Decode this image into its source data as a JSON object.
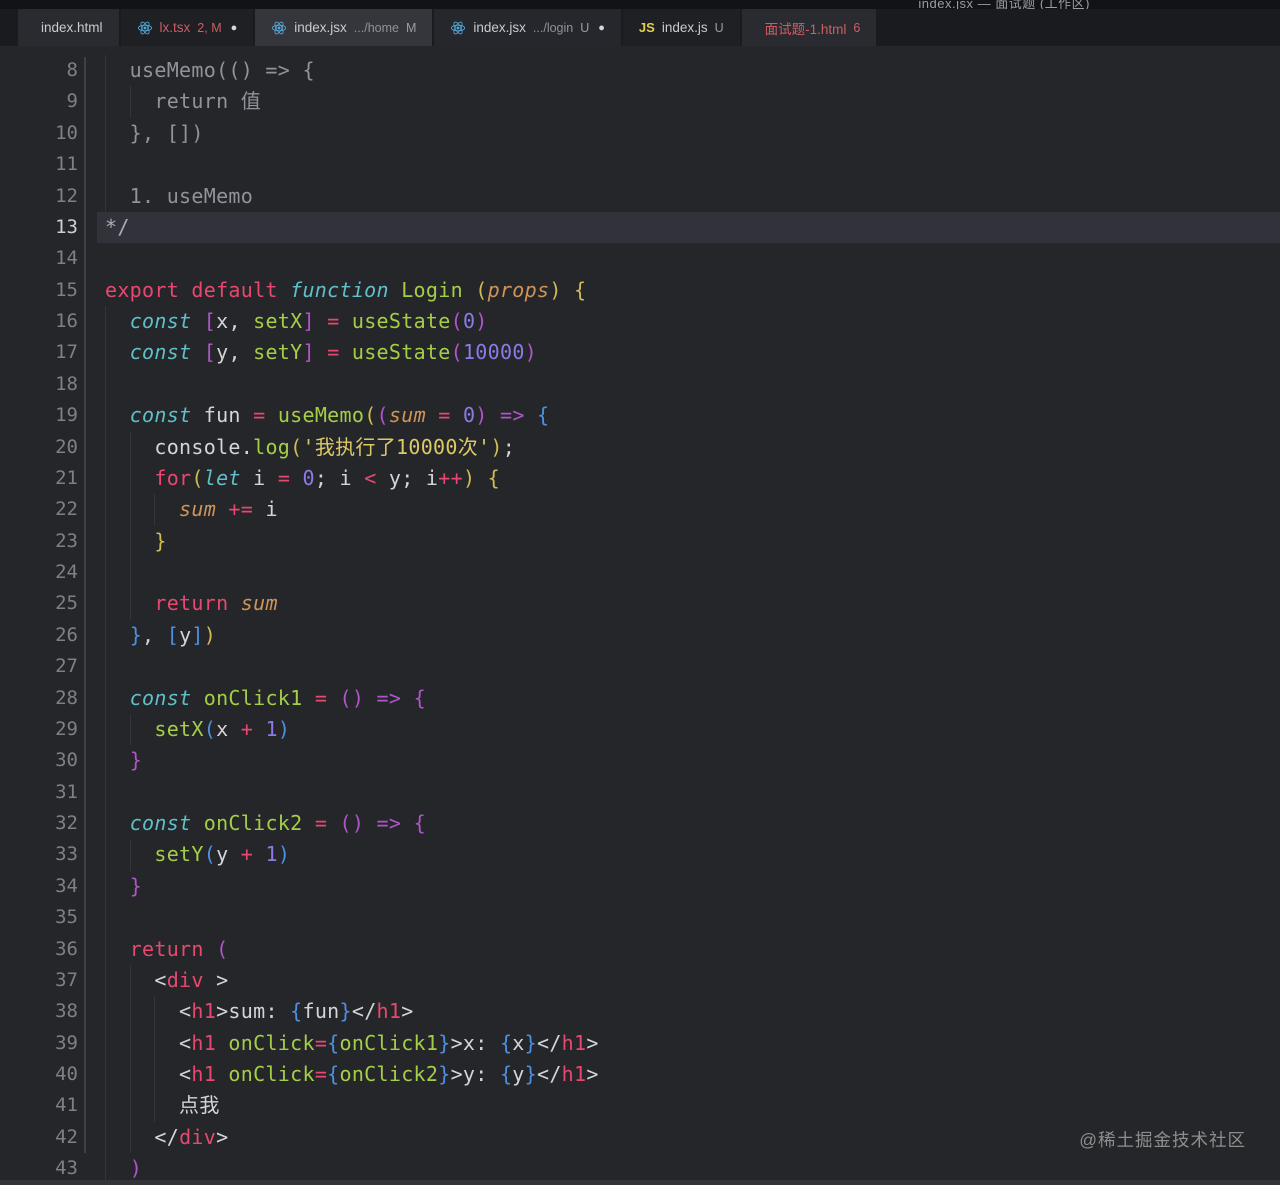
{
  "window": {
    "title": "index.jsx — 面试题 (工作区)"
  },
  "tabs": [
    {
      "icon": "code-icon",
      "label": "index.html",
      "detail": "",
      "suffix": "",
      "dirty": false,
      "error": false,
      "shade": "mid"
    },
    {
      "icon": "react-icon",
      "label": "lx.tsx",
      "detail": "",
      "suffix": "2, M",
      "dirty": true,
      "error": true,
      "shade": "dark"
    },
    {
      "icon": "react-icon",
      "label": "index.jsx",
      "detail": ".../home",
      "suffix": "M",
      "dirty": false,
      "error": false,
      "shade": "light"
    },
    {
      "icon": "react-icon",
      "label": "index.jsx",
      "detail": ".../login",
      "suffix": "U",
      "dirty": true,
      "error": false,
      "shade": "middark"
    },
    {
      "icon": "js-icon",
      "label": "index.js",
      "detail": "",
      "suffix": "U",
      "dirty": false,
      "error": false,
      "shade": "dark"
    },
    {
      "icon": "code-icon",
      "label": "面试题-1.html",
      "detail": "",
      "suffix": "6",
      "dirty": false,
      "error": true,
      "shade": "mid"
    }
  ],
  "colors": {
    "c": "#90939b",
    "c2": "#a8acb4",
    "kw": "#e8486f",
    "st": "#5fc0c9",
    "fn": "#a5ce47",
    "pm": "#d09457",
    "nu": "#8d79e8",
    "sr": "#ddc966",
    "pl": "#d4d5d8",
    "by": "#cfbc55",
    "bp": "#b055c9",
    "bb": "#4e90e0",
    "tg": "#e8486f",
    "accent_react": "#53aede"
  },
  "editor": {
    "first_line": 8,
    "active_line": 13,
    "lines": [
      [
        [
          "  useMemo(() => {",
          "c"
        ]
      ],
      [
        [
          "    return 值",
          "c"
        ]
      ],
      [
        [
          "  }, [])",
          "c"
        ]
      ],
      [],
      [
        [
          "  1. useMemo",
          "c"
        ]
      ],
      [
        [
          "*/",
          "c2"
        ]
      ],
      [],
      [
        [
          "export",
          "kw"
        ],
        [
          " ",
          "pl"
        ],
        [
          "default",
          "kw"
        ],
        [
          " ",
          "pl"
        ],
        [
          "function",
          "st"
        ],
        [
          " ",
          "pl"
        ],
        [
          "Login",
          "fn"
        ],
        [
          " ",
          "pl"
        ],
        [
          "(",
          "by"
        ],
        [
          "props",
          "pm"
        ],
        [
          ")",
          "by"
        ],
        [
          " ",
          "pl"
        ],
        [
          "{",
          "by"
        ]
      ],
      [
        [
          "  ",
          "pl"
        ],
        [
          "const",
          "st"
        ],
        [
          " ",
          "pl"
        ],
        [
          "[",
          "bp"
        ],
        [
          "x",
          "pl"
        ],
        [
          ", ",
          "pl"
        ],
        [
          "setX",
          "fn"
        ],
        [
          "]",
          "bp"
        ],
        [
          " ",
          "pl"
        ],
        [
          "=",
          "kw"
        ],
        [
          " ",
          "pl"
        ],
        [
          "useState",
          "fn"
        ],
        [
          "(",
          "bp"
        ],
        [
          "0",
          "nu"
        ],
        [
          ")",
          "bp"
        ]
      ],
      [
        [
          "  ",
          "pl"
        ],
        [
          "const",
          "st"
        ],
        [
          " ",
          "pl"
        ],
        [
          "[",
          "bp"
        ],
        [
          "y",
          "pl"
        ],
        [
          ", ",
          "pl"
        ],
        [
          "setY",
          "fn"
        ],
        [
          "]",
          "bp"
        ],
        [
          " ",
          "pl"
        ],
        [
          "=",
          "kw"
        ],
        [
          " ",
          "pl"
        ],
        [
          "useState",
          "fn"
        ],
        [
          "(",
          "bp"
        ],
        [
          "10000",
          "nu"
        ],
        [
          ")",
          "bp"
        ]
      ],
      [],
      [
        [
          "  ",
          "pl"
        ],
        [
          "const",
          "st"
        ],
        [
          " ",
          "pl"
        ],
        [
          "fun",
          "pl"
        ],
        [
          " ",
          "pl"
        ],
        [
          "=",
          "kw"
        ],
        [
          " ",
          "pl"
        ],
        [
          "useMemo",
          "fn"
        ],
        [
          "(",
          "by"
        ],
        [
          "(",
          "bp"
        ],
        [
          "sum",
          "pm"
        ],
        [
          " ",
          "pl"
        ],
        [
          "=",
          "kw"
        ],
        [
          " ",
          "pl"
        ],
        [
          "0",
          "nu"
        ],
        [
          ")",
          "bp"
        ],
        [
          " ",
          "pl"
        ],
        [
          "=>",
          "bp"
        ],
        [
          " ",
          "pl"
        ],
        [
          "{",
          "bb"
        ]
      ],
      [
        [
          "    ",
          "pl"
        ],
        [
          "console",
          "pl"
        ],
        [
          ".",
          "pl"
        ],
        [
          "log",
          "fn"
        ],
        [
          "(",
          "by"
        ],
        [
          "'我执行了10000次'",
          "sr"
        ],
        [
          ")",
          "by"
        ],
        [
          ";",
          "pl"
        ]
      ],
      [
        [
          "    ",
          "pl"
        ],
        [
          "for",
          "kw"
        ],
        [
          "(",
          "by"
        ],
        [
          "let",
          "st"
        ],
        [
          " i ",
          "pl"
        ],
        [
          "=",
          "kw"
        ],
        [
          " ",
          "pl"
        ],
        [
          "0",
          "nu"
        ],
        [
          "; i ",
          "pl"
        ],
        [
          "<",
          "kw"
        ],
        [
          " y; i",
          "pl"
        ],
        [
          "++",
          "kw"
        ],
        [
          ")",
          "by"
        ],
        [
          " ",
          "pl"
        ],
        [
          "{",
          "by"
        ]
      ],
      [
        [
          "      ",
          "pl"
        ],
        [
          "sum",
          "pm"
        ],
        [
          " ",
          "pl"
        ],
        [
          "+=",
          "kw"
        ],
        [
          " i",
          "pl"
        ]
      ],
      [
        [
          "    ",
          "pl"
        ],
        [
          "}",
          "by"
        ]
      ],
      [],
      [
        [
          "    ",
          "pl"
        ],
        [
          "return",
          "kw"
        ],
        [
          " ",
          "pl"
        ],
        [
          "sum",
          "pm"
        ]
      ],
      [
        [
          "  ",
          "pl"
        ],
        [
          "}",
          "bb"
        ],
        [
          ", ",
          "pl"
        ],
        [
          "[",
          "bb"
        ],
        [
          "y",
          "pl"
        ],
        [
          "]",
          "bb"
        ],
        [
          ")",
          "by"
        ]
      ],
      [],
      [
        [
          "  ",
          "pl"
        ],
        [
          "const",
          "st"
        ],
        [
          " ",
          "pl"
        ],
        [
          "onClick1",
          "fn"
        ],
        [
          " ",
          "pl"
        ],
        [
          "=",
          "kw"
        ],
        [
          " ",
          "pl"
        ],
        [
          "(",
          "bp"
        ],
        [
          ")",
          "bp"
        ],
        [
          " ",
          "pl"
        ],
        [
          "=>",
          "bp"
        ],
        [
          " ",
          "pl"
        ],
        [
          "{",
          "bp"
        ]
      ],
      [
        [
          "    ",
          "pl"
        ],
        [
          "setX",
          "fn"
        ],
        [
          "(",
          "bb"
        ],
        [
          "x ",
          "pl"
        ],
        [
          "+",
          "kw"
        ],
        [
          " ",
          "pl"
        ],
        [
          "1",
          "nu"
        ],
        [
          ")",
          "bb"
        ]
      ],
      [
        [
          "  ",
          "pl"
        ],
        [
          "}",
          "bp"
        ]
      ],
      [],
      [
        [
          "  ",
          "pl"
        ],
        [
          "const",
          "st"
        ],
        [
          " ",
          "pl"
        ],
        [
          "onClick2",
          "fn"
        ],
        [
          " ",
          "pl"
        ],
        [
          "=",
          "kw"
        ],
        [
          " ",
          "pl"
        ],
        [
          "(",
          "bp"
        ],
        [
          ")",
          "bp"
        ],
        [
          " ",
          "pl"
        ],
        [
          "=>",
          "bp"
        ],
        [
          " ",
          "pl"
        ],
        [
          "{",
          "bp"
        ]
      ],
      [
        [
          "    ",
          "pl"
        ],
        [
          "setY",
          "fn"
        ],
        [
          "(",
          "bb"
        ],
        [
          "y ",
          "pl"
        ],
        [
          "+",
          "kw"
        ],
        [
          " ",
          "pl"
        ],
        [
          "1",
          "nu"
        ],
        [
          ")",
          "bb"
        ]
      ],
      [
        [
          "  ",
          "pl"
        ],
        [
          "}",
          "bp"
        ]
      ],
      [],
      [
        [
          "  ",
          "pl"
        ],
        [
          "return",
          "kw"
        ],
        [
          " ",
          "pl"
        ],
        [
          "(",
          "bp"
        ]
      ],
      [
        [
          "    ",
          "pl"
        ],
        [
          "<",
          "pl"
        ],
        [
          "div",
          "tg"
        ],
        [
          " >",
          "pl"
        ]
      ],
      [
        [
          "      ",
          "pl"
        ],
        [
          "<",
          "pl"
        ],
        [
          "h1",
          "tg"
        ],
        [
          ">",
          "pl"
        ],
        [
          "sum: ",
          "pl"
        ],
        [
          "{",
          "bb"
        ],
        [
          "fun",
          "pl"
        ],
        [
          "}",
          "bb"
        ],
        [
          "</",
          "pl"
        ],
        [
          "h1",
          "tg"
        ],
        [
          ">",
          "pl"
        ]
      ],
      [
        [
          "      ",
          "pl"
        ],
        [
          "<",
          "pl"
        ],
        [
          "h1",
          "tg"
        ],
        [
          " ",
          "pl"
        ],
        [
          "onClick",
          "fn"
        ],
        [
          "=",
          "kw"
        ],
        [
          "{",
          "bb"
        ],
        [
          "onClick1",
          "fn"
        ],
        [
          "}",
          "bb"
        ],
        [
          ">",
          "pl"
        ],
        [
          "x: ",
          "pl"
        ],
        [
          "{",
          "bb"
        ],
        [
          "x",
          "pl"
        ],
        [
          "}",
          "bb"
        ],
        [
          "</",
          "pl"
        ],
        [
          "h1",
          "tg"
        ],
        [
          ">",
          "pl"
        ]
      ],
      [
        [
          "      ",
          "pl"
        ],
        [
          "<",
          "pl"
        ],
        [
          "h1",
          "tg"
        ],
        [
          " ",
          "pl"
        ],
        [
          "onClick",
          "fn"
        ],
        [
          "=",
          "kw"
        ],
        [
          "{",
          "bb"
        ],
        [
          "onClick2",
          "fn"
        ],
        [
          "}",
          "bb"
        ],
        [
          ">",
          "pl"
        ],
        [
          "y: ",
          "pl"
        ],
        [
          "{",
          "bb"
        ],
        [
          "y",
          "pl"
        ],
        [
          "}",
          "bb"
        ],
        [
          "</",
          "pl"
        ],
        [
          "h1",
          "tg"
        ],
        [
          ">",
          "pl"
        ]
      ],
      [
        [
          "      ",
          "pl"
        ],
        [
          "点我",
          "pl"
        ]
      ],
      [
        [
          "    ",
          "pl"
        ],
        [
          "</",
          "pl"
        ],
        [
          "div",
          "tg"
        ],
        [
          ">",
          "pl"
        ]
      ],
      [
        [
          "  ",
          "pl"
        ],
        [
          ")",
          "bp"
        ]
      ]
    ]
  },
  "watermark": "@稀土掘金技术社区",
  "icons": {
    "code_glyph": "</>",
    "js_glyph": "JS",
    "dirty_dot": "●"
  }
}
